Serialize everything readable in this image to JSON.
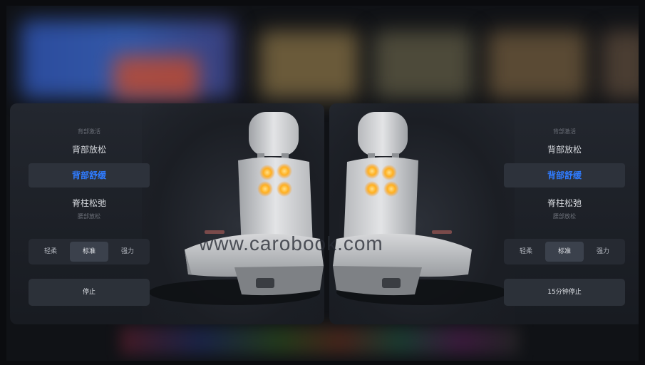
{
  "left_panel": {
    "modes": [
      "背部激活",
      "背部放松",
      "背部舒缓",
      "脊柱松弛",
      "腰部放松"
    ],
    "selected_mode": "背部舒缓",
    "intensity": {
      "options": [
        "轻柔",
        "标准",
        "强力"
      ],
      "selected": "标准"
    },
    "stop_label": "停止"
  },
  "right_panel": {
    "modes": [
      "背部激活",
      "背部放松",
      "背部舒缓",
      "脊柱松弛",
      "腰部放松"
    ],
    "selected_mode": "背部舒缓",
    "intensity": {
      "options": [
        "轻柔",
        "标准",
        "强力"
      ],
      "selected": "标准"
    },
    "stop_label": "15分钟停止"
  },
  "watermark": "www.carobook.com",
  "colors": {
    "accent": "#2f7bff",
    "massage_point": "#ffb020"
  }
}
